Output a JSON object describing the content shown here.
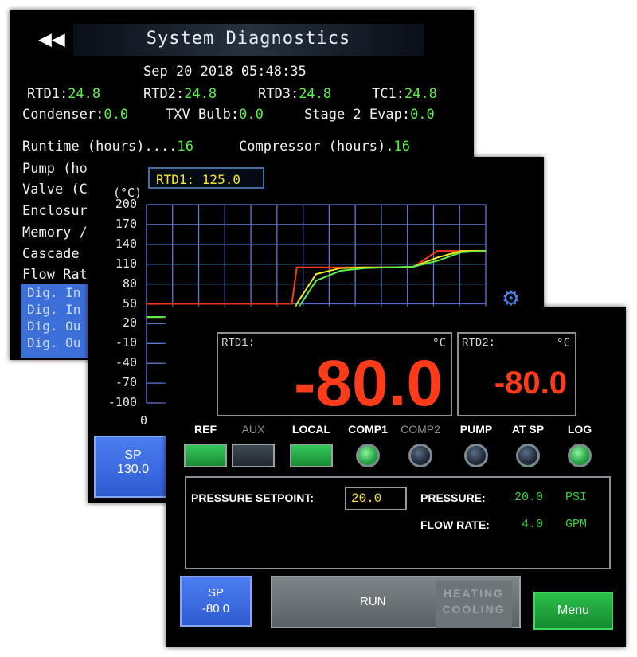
{
  "diagnostics": {
    "title": "System Diagnostics",
    "back_icon": "double-chevron-left-icon",
    "datetime": "Sep 20 2018   05:48:35",
    "temps": [
      {
        "label": "RTD1:",
        "value": "24.8"
      },
      {
        "label": "RTD2:",
        "value": "24.8"
      },
      {
        "label": "RTD3:",
        "value": "24.8"
      },
      {
        "label": "TC1:",
        "value": "24.8"
      }
    ],
    "sensors": [
      {
        "label": "Condenser:",
        "value": "0.0"
      },
      {
        "label": "TXV Bulb:",
        "value": "0.0"
      },
      {
        "label": "Stage 2 Evap:",
        "value": "0.0"
      }
    ],
    "runtime": {
      "label": "Runtime (hours)....",
      "value": "16"
    },
    "compressor": {
      "label": "Compressor (hours).",
      "value": "16"
    },
    "rows": [
      "Pump (ho",
      "Valve (C",
      "Enclosur",
      "Memory /",
      "Cascade",
      "Flow Rat"
    ],
    "dig": [
      "Dig. In",
      "Dig. In",
      "Dig. Ou",
      "Dig. Ou"
    ]
  },
  "trend": {
    "rtd_label": "RTD1: 125.0",
    "unit": "(°C)",
    "x_zero": "0",
    "gear_icon": "gear-icon",
    "sp_button": {
      "label": "SP",
      "value": "130.0"
    }
  },
  "chart_data": {
    "type": "line",
    "ylabel": "(°C)",
    "ylim": [
      -100,
      200
    ],
    "yticks": [
      "200",
      "170",
      "140",
      "110",
      "80",
      "50",
      "20",
      "-10",
      "-40",
      "-70",
      "-100"
    ],
    "grid": true,
    "x": [
      0,
      1,
      2,
      3,
      4,
      5,
      6,
      6.2,
      7,
      8,
      9,
      10,
      11,
      12,
      13,
      14
    ],
    "series": [
      {
        "color": "#ff3a1a",
        "values": [
          50,
          50,
          50,
          50,
          50,
          50,
          50,
          105,
          105,
          105,
          105,
          105,
          105,
          130,
          130,
          130
        ]
      },
      {
        "color": "#f5ea1c",
        "values": [
          30,
          30,
          30,
          30,
          30,
          30,
          30,
          50,
          95,
          104,
          105,
          105,
          106,
          120,
          130,
          130
        ]
      },
      {
        "color": "#5df04a",
        "values": [
          30,
          30,
          30,
          30,
          30,
          30,
          30,
          40,
          85,
          100,
          104,
          105,
          106,
          115,
          128,
          130
        ]
      }
    ]
  },
  "control": {
    "rtd1": {
      "label": "RTD1:",
      "unit": "°C",
      "value": "-80.0"
    },
    "rtd2": {
      "label": "RTD2:",
      "unit": "°C",
      "value": "-80.0"
    },
    "indicators": [
      {
        "label": "REF",
        "type": "button",
        "active": true
      },
      {
        "label": "AUX",
        "type": "button",
        "active": false
      },
      {
        "label": "LOCAL",
        "type": "button",
        "active": true
      },
      {
        "label": "COMP1",
        "type": "led",
        "active": true
      },
      {
        "label": "COMP2",
        "type": "led",
        "active": false
      },
      {
        "label": "PUMP",
        "type": "led",
        "active": false
      },
      {
        "label": "AT SP",
        "type": "led",
        "active": false
      },
      {
        "label": "LOG",
        "type": "led",
        "active": true
      }
    ],
    "pressure_setpoint": {
      "label": "PRESSURE SETPOINT:",
      "value": "20.0"
    },
    "pressure": {
      "label": "PRESSURE:",
      "value": "20.0",
      "unit": "PSI"
    },
    "flow_rate": {
      "label": "FLOW RATE:",
      "value": "4.0",
      "unit": "GPM"
    },
    "sp_button": {
      "label": "SP",
      "value": "-80.0"
    },
    "run_button": {
      "label": "RUN",
      "heating": "HEATING",
      "cooling": "COOLING"
    },
    "menu_button": {
      "label": "Menu"
    },
    "colors": {
      "active_green": "#2fbf4f",
      "readout_red": "#ff3b1a",
      "value_green": "#35d13a",
      "setpoint_yellow": "#f7e62f"
    }
  }
}
